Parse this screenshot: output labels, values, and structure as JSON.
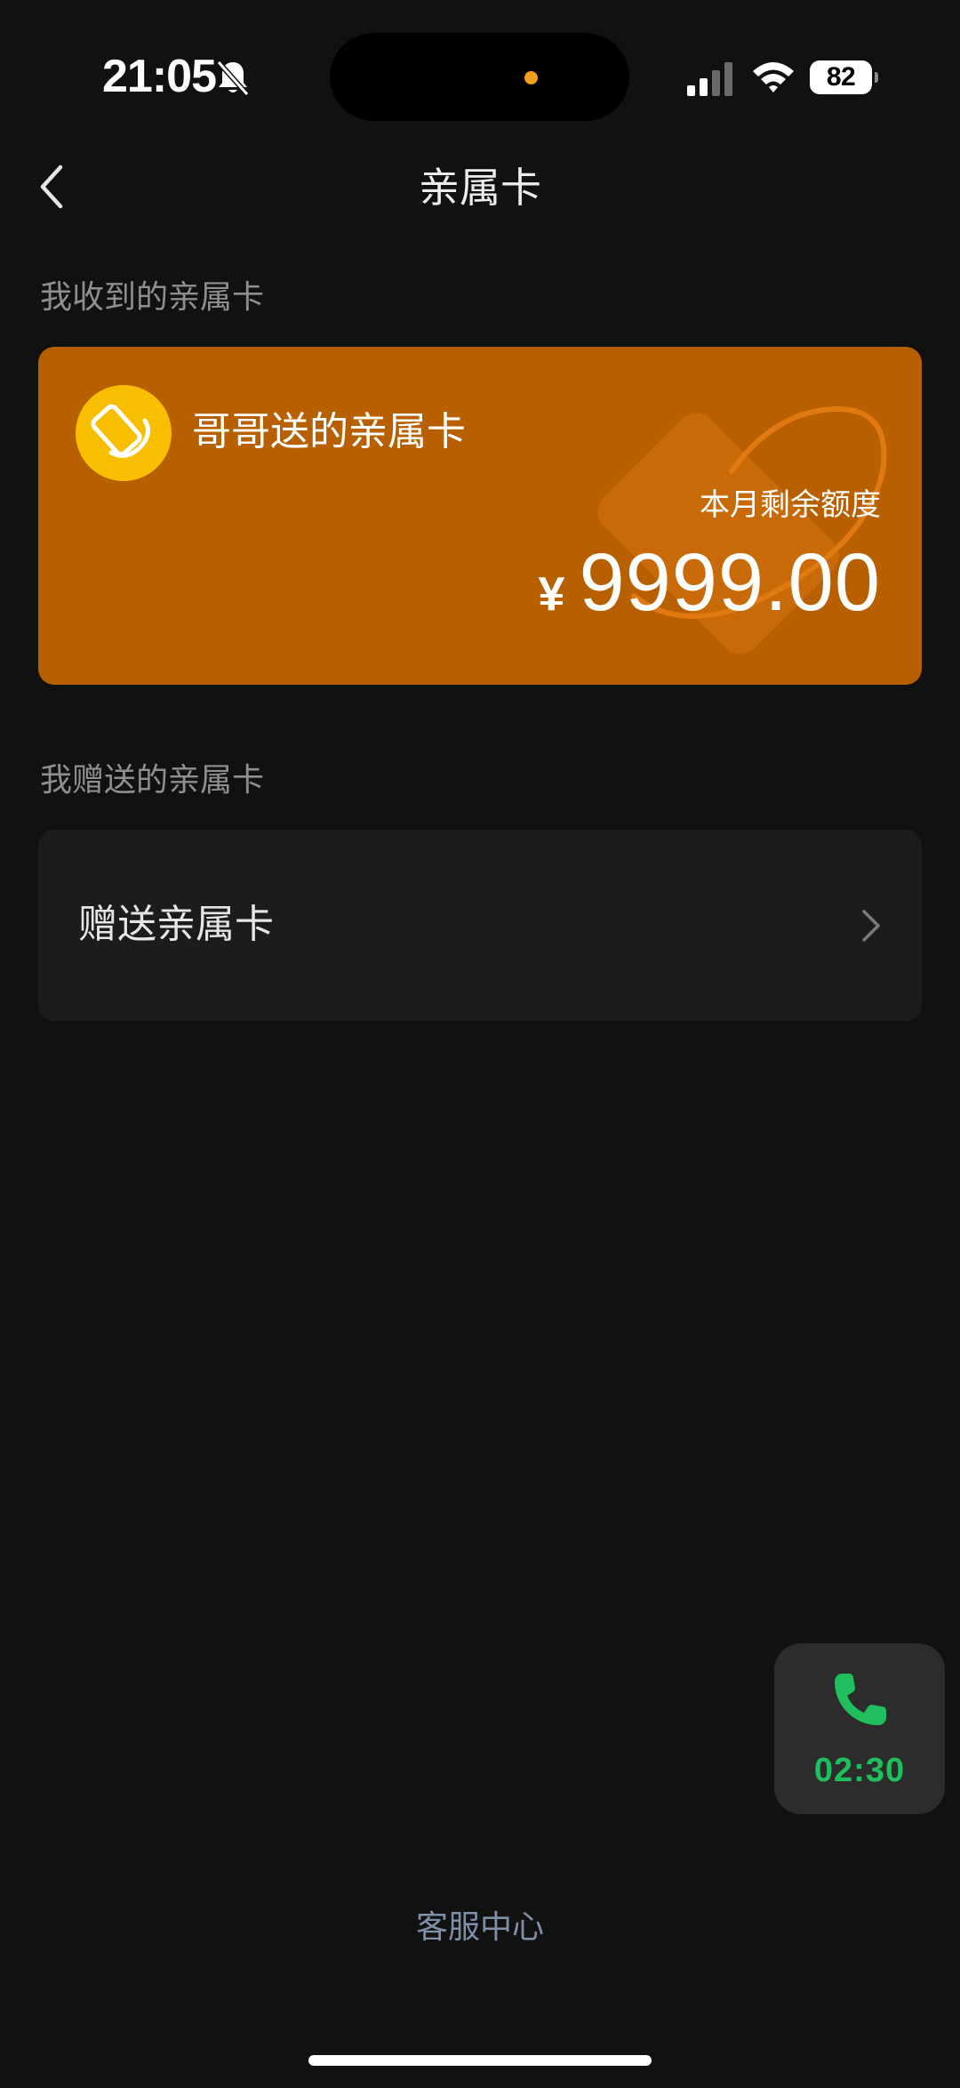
{
  "status_bar": {
    "time": "21:05",
    "battery": "82",
    "icons": [
      "bell-muted-icon",
      "signal-icon",
      "wifi-icon",
      "battery-icon"
    ]
  },
  "nav": {
    "title": "亲属卡",
    "back_icon": "chevron-left-icon"
  },
  "received": {
    "section_label": "我收到的亲属卡",
    "card": {
      "title": "哥哥送的亲属卡",
      "balance_label": "本月剩余额度",
      "currency": "¥",
      "amount": "9999.00",
      "background_color": "#b86000",
      "avatar_color": "#f8bf00"
    }
  },
  "gifted": {
    "section_label": "我赠送的亲属卡",
    "row_label": "赠送亲属卡",
    "row_icon": "chevron-right-icon"
  },
  "call_widget": {
    "timer": "02:30",
    "icon": "phone-icon",
    "color": "#1fbf5e"
  },
  "footer": {
    "service_link": "客服中心"
  }
}
